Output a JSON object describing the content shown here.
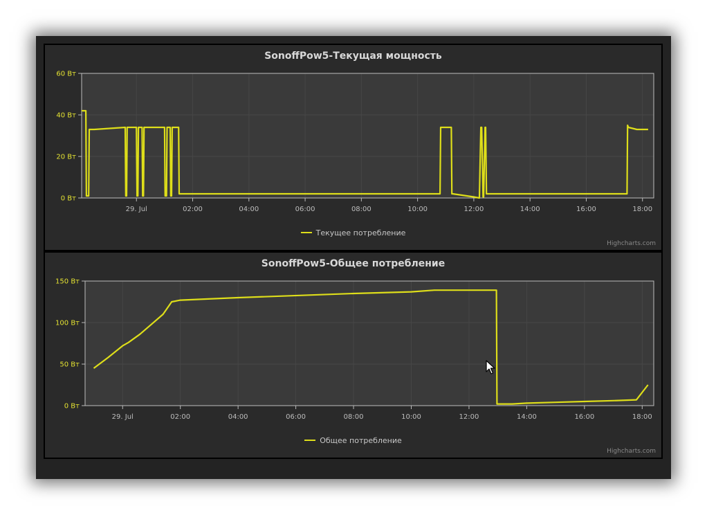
{
  "colors": {
    "series": "#dede1a",
    "plot_bg": "#3a3a3a",
    "panel_bg": "#2a2a2a",
    "window_bg": "#232323"
  },
  "icons": {
    "cursor": "mouse-pointer-icon"
  },
  "chart_data": [
    {
      "type": "line",
      "title": "SonoffPow5-Текущая мощность",
      "xlabel": "",
      "ylabel": "",
      "x_unit": "hours since 29. Jul 00:00",
      "xlim": [
        -1.95,
        18.4
      ],
      "ylim": [
        0,
        60
      ],
      "yticks": [
        0,
        20,
        40,
        60
      ],
      "ytick_labels": [
        "0 Вт",
        "20 Вт",
        "40 Вт",
        "60 Вт"
      ],
      "xticks": [
        0,
        2,
        4,
        6,
        8,
        10,
        12,
        14,
        16,
        18
      ],
      "xtick_labels": [
        "29. Jul",
        "02:00",
        "04:00",
        "06:00",
        "08:00",
        "10:00",
        "12:00",
        "14:00",
        "16:00",
        "18:00"
      ],
      "grid": true,
      "legend": "bottom-center",
      "credits": "Highcharts.com",
      "series": [
        {
          "name": "Текущее потребление",
          "x": [
            -1.95,
            -1.8,
            -1.78,
            -1.7,
            -1.68,
            -1.5,
            -0.4,
            -0.38,
            -0.35,
            -0.33,
            0.0,
            0.02,
            0.05,
            0.07,
            0.2,
            0.22,
            0.25,
            0.27,
            1.0,
            1.02,
            1.07,
            1.09,
            1.2,
            1.22,
            1.25,
            1.27,
            1.5,
            1.52,
            1.55,
            8.0,
            10.8,
            10.82,
            10.85,
            11.2,
            11.22,
            11.25,
            12.0,
            12.2,
            12.25,
            12.28,
            12.33,
            12.35,
            12.4,
            12.42,
            12.45,
            12.48,
            14.0,
            16.0,
            17.45,
            17.47,
            17.5,
            17.8,
            18.2
          ],
          "values": [
            42,
            42,
            1,
            1,
            33,
            33,
            34,
            1,
            1,
            34,
            34,
            1,
            1,
            34,
            34,
            1,
            1,
            34,
            34,
            1,
            1,
            34,
            34,
            1,
            1,
            34,
            34,
            2,
            2,
            2,
            2,
            34,
            34,
            34,
            2,
            2,
            0.5,
            0,
            34,
            34,
            0.5,
            0.5,
            34,
            34,
            2,
            2,
            2,
            2,
            2,
            35,
            34,
            33,
            33
          ]
        }
      ]
    },
    {
      "type": "line",
      "title": "SonoffPow5-Общее потребление",
      "xlabel": "",
      "ylabel": "",
      "x_unit": "hours since 29. Jul 00:00",
      "xlim": [
        -1.3,
        18.4
      ],
      "ylim": [
        0,
        150
      ],
      "yticks": [
        0,
        50,
        100,
        150
      ],
      "ytick_labels": [
        "0 Вт",
        "50 Вт",
        "100 Вт",
        "150 Вт"
      ],
      "xticks": [
        0,
        2,
        4,
        6,
        8,
        10,
        12,
        14,
        16,
        18
      ],
      "xtick_labels": [
        "29. Jul",
        "02:00",
        "04:00",
        "06:00",
        "08:00",
        "10:00",
        "12:00",
        "14:00",
        "16:00",
        "18:00"
      ],
      "grid": true,
      "legend": "bottom-center",
      "credits": "Highcharts.com",
      "series": [
        {
          "name": "Общее потребление",
          "x": [
            -1.0,
            -0.5,
            0.0,
            0.2,
            0.6,
            1.0,
            1.4,
            1.7,
            2.0,
            4.0,
            8.0,
            10.0,
            10.8,
            12.95,
            12.97,
            13.5,
            14.0,
            15.0,
            16.0,
            17.0,
            17.8,
            18.2
          ],
          "values": [
            45,
            58,
            72,
            76,
            86,
            98,
            110,
            125,
            127,
            130,
            135,
            137,
            139,
            139,
            2,
            2,
            3,
            4,
            5,
            6,
            7,
            25
          ]
        }
      ]
    }
  ]
}
